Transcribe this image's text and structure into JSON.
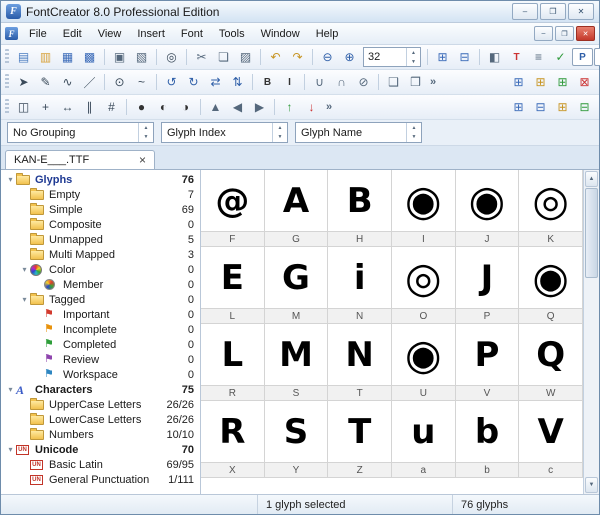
{
  "window": {
    "title": "FontCreator 8.0 Professional Edition",
    "controls": {
      "minimize": "‒",
      "maximize": "❐",
      "close": "✕"
    }
  },
  "menu": {
    "items": [
      "File",
      "Edit",
      "View",
      "Insert",
      "Font",
      "Tools",
      "Window",
      "Help"
    ]
  },
  "toolbars": {
    "rows": [
      [
        {
          "type": "grip"
        },
        {
          "type": "icon",
          "name": "new-font-icon",
          "glyph": "▤",
          "color": "#4a7cc0"
        },
        {
          "type": "icon",
          "name": "open-font-icon",
          "glyph": "▥",
          "color": "#d8a23c"
        },
        {
          "type": "icon",
          "name": "save-font-icon",
          "glyph": "▦",
          "color": "#3a6ab8"
        },
        {
          "type": "icon",
          "name": "save-all-icon",
          "glyph": "▩",
          "color": "#3a6ab8"
        },
        {
          "type": "sep"
        },
        {
          "type": "icon",
          "name": "print-icon",
          "glyph": "▣",
          "color": "#55687c"
        },
        {
          "type": "icon",
          "name": "print-preview-icon",
          "glyph": "▧",
          "color": "#55687c"
        },
        {
          "type": "sep"
        },
        {
          "type": "icon",
          "name": "find-icon",
          "glyph": "◎",
          "color": "#3a4a5a"
        },
        {
          "type": "sep"
        },
        {
          "type": "icon",
          "name": "cut-icon",
          "glyph": "✂",
          "color": "#55687c"
        },
        {
          "type": "icon",
          "name": "copy-icon",
          "glyph": "❏",
          "color": "#55687c"
        },
        {
          "type": "icon",
          "name": "paste-icon",
          "glyph": "▨",
          "color": "#55687c"
        },
        {
          "type": "sep"
        },
        {
          "type": "icon",
          "name": "undo-icon",
          "glyph": "↶",
          "color": "#c79422"
        },
        {
          "type": "icon",
          "name": "redo-icon",
          "glyph": "↷",
          "color": "#c79422"
        },
        {
          "type": "sep"
        },
        {
          "type": "icon",
          "name": "zoom-out-icon",
          "glyph": "⊖",
          "color": "#2f5fa8"
        },
        {
          "type": "icon",
          "name": "zoom-in-icon",
          "glyph": "⊕",
          "color": "#2f5fa8"
        },
        {
          "type": "zoom",
          "value": "32"
        },
        {
          "type": "sep"
        },
        {
          "type": "icon",
          "name": "glyph-grid-icon",
          "glyph": "⊞",
          "color": "#3a6ab8"
        },
        {
          "type": "icon",
          "name": "cascade-windows-icon",
          "glyph": "⊟",
          "color": "#3a6ab8"
        },
        {
          "type": "sep"
        },
        {
          "type": "icon",
          "name": "transform-icon",
          "glyph": "◧",
          "color": "#55687c"
        },
        {
          "type": "icon",
          "name": "test-font-icon",
          "glyph": "T",
          "color": "#cc3333",
          "letter": true
        },
        {
          "type": "icon",
          "name": "glyph-names-icon",
          "glyph": "≡",
          "color": "#55687c"
        },
        {
          "type": "icon",
          "name": "validate-icon",
          "glyph": "✓",
          "color": "#2f9a3a"
        },
        {
          "type": "icon",
          "name": "properties-icon",
          "glyph": "P",
          "color": "#2f5fa8",
          "letter": true,
          "box": true
        },
        {
          "type": "icon",
          "name": "ti-icon",
          "glyph": "TI",
          "color": "#2f5fa8",
          "letter": true,
          "box": true
        },
        {
          "type": "gap"
        },
        {
          "type": "icon",
          "name": "pilcrow-icon",
          "glyph": "¶",
          "color": "#3a6ab8"
        },
        {
          "type": "icon",
          "name": "compare-icon",
          "glyph": "◫",
          "color": "#3a6ab8"
        },
        {
          "type": "chevron"
        }
      ],
      [
        {
          "type": "grip"
        },
        {
          "type": "icon",
          "name": "pointer-icon",
          "glyph": "➤",
          "color": "#3a4a5a"
        },
        {
          "type": "icon",
          "name": "draw-icon",
          "glyph": "✎",
          "color": "#3a4a5a"
        },
        {
          "type": "icon",
          "name": "contour-icon",
          "glyph": "∿",
          "color": "#3a4a5a"
        },
        {
          "type": "icon",
          "name": "knife-icon",
          "glyph": "／",
          "color": "#3a4a5a"
        },
        {
          "type": "sep"
        },
        {
          "type": "icon",
          "name": "add-point-icon",
          "glyph": "⊙",
          "color": "#3a4a5a"
        },
        {
          "type": "icon",
          "name": "curve-icon",
          "glyph": "~",
          "color": "#3a4a5a"
        },
        {
          "type": "sep"
        },
        {
          "type": "icon",
          "name": "rotate-ccw-icon",
          "glyph": "↺",
          "color": "#2f5fa8"
        },
        {
          "type": "icon",
          "name": "rotate-cw-icon",
          "glyph": "↻",
          "color": "#2f5fa8"
        },
        {
          "type": "icon",
          "name": "flip-horizontal-icon",
          "glyph": "⇄",
          "color": "#2f5fa8"
        },
        {
          "type": "icon",
          "name": "flip-vertical-icon",
          "glyph": "⇅",
          "color": "#2f5fa8"
        },
        {
          "type": "sep"
        },
        {
          "type": "icon",
          "name": "bold-icon",
          "glyph": "B",
          "color": "#333333",
          "letter": true
        },
        {
          "type": "icon",
          "name": "italic-icon",
          "glyph": "I",
          "color": "#333333",
          "letter": true
        },
        {
          "type": "sep"
        },
        {
          "type": "icon",
          "name": "union-icon",
          "glyph": "∪",
          "color": "#55687c"
        },
        {
          "type": "icon",
          "name": "intersect-icon",
          "glyph": "∩",
          "color": "#55687c"
        },
        {
          "type": "icon",
          "name": "exclude-icon",
          "glyph": "⊘",
          "color": "#55687c"
        },
        {
          "type": "sep"
        },
        {
          "type": "icon",
          "name": "group-icon",
          "glyph": "❑",
          "color": "#55687c"
        },
        {
          "type": "icon",
          "name": "ungroup-icon",
          "glyph": "❒",
          "color": "#55687c"
        },
        {
          "type": "chevron"
        },
        {
          "type": "gap"
        },
        {
          "type": "icon",
          "name": "tile-horizontal-icon",
          "glyph": "⊞",
          "color": "#3a6ab8"
        },
        {
          "type": "icon",
          "name": "tile-vertical-icon",
          "glyph": "⊞",
          "color": "#c79422"
        },
        {
          "type": "icon",
          "name": "new-window-icon",
          "glyph": "⊞",
          "color": "#2f9a3a"
        },
        {
          "type": "icon",
          "name": "close-window-icon",
          "glyph": "⊠",
          "color": "#cc3333"
        }
      ],
      [
        {
          "type": "grip"
        },
        {
          "type": "icon",
          "name": "eraser-icon",
          "glyph": "◫",
          "color": "#3a4a5a"
        },
        {
          "type": "icon",
          "name": "move-icon",
          "glyph": "+",
          "color": "#3a4a5a"
        },
        {
          "type": "icon",
          "name": "measure-icon",
          "glyph": "↔",
          "color": "#3a4a5a"
        },
        {
          "type": "icon",
          "name": "guides-icon",
          "glyph": "∥",
          "color": "#3a4a5a"
        },
        {
          "type": "icon",
          "name": "snap-grid-icon",
          "glyph": "#",
          "color": "#3a4a5a"
        },
        {
          "type": "sep"
        },
        {
          "type": "icon",
          "name": "ellipse-icon",
          "glyph": "●",
          "color": "#333333"
        },
        {
          "type": "icon",
          "name": "contrast-left-icon",
          "glyph": "◐",
          "color": "#333333"
        },
        {
          "type": "icon",
          "name": "contrast-right-icon",
          "glyph": "◑",
          "color": "#333333"
        },
        {
          "type": "sep"
        },
        {
          "type": "icon",
          "name": "align-top-icon",
          "glyph": "▲",
          "color": "#55687c"
        },
        {
          "type": "icon",
          "name": "align-left-icon",
          "glyph": "◀",
          "color": "#55687c"
        },
        {
          "type": "icon",
          "name": "align-right-icon",
          "glyph": "▶",
          "color": "#55687c"
        },
        {
          "type": "sep"
        },
        {
          "type": "icon",
          "name": "raise-icon",
          "glyph": "↑",
          "color": "#2f9a3a"
        },
        {
          "type": "icon",
          "name": "lower-icon",
          "glyph": "↓",
          "color": "#cc3333"
        },
        {
          "type": "chevron"
        },
        {
          "type": "gap"
        },
        {
          "type": "icon",
          "name": "table-view-icon",
          "glyph": "⊞",
          "color": "#3a6ab8"
        },
        {
          "type": "icon",
          "name": "split-view-icon",
          "glyph": "⊟",
          "color": "#3a6ab8"
        },
        {
          "type": "icon",
          "name": "chart-view-icon",
          "glyph": "⊞",
          "color": "#c79422"
        },
        {
          "type": "icon",
          "name": "report-view-icon",
          "glyph": "⊟",
          "color": "#2f9a3a"
        }
      ]
    ]
  },
  "grouping": {
    "combos": [
      {
        "name": "grouping-select",
        "value": "No Grouping"
      },
      {
        "name": "glyph-index-select",
        "value": "Glyph Index"
      },
      {
        "name": "glyph-name-select",
        "value": "Glyph Name"
      }
    ]
  },
  "tab": {
    "label": "KAN-E___.TTF",
    "close": "×"
  },
  "tree": {
    "items": [
      {
        "label": "Glyphs",
        "count": "76",
        "level": 0,
        "icon": "folder",
        "caret": true,
        "bold": true,
        "color": "#1f3a93"
      },
      {
        "label": "Empty",
        "count": "7",
        "level": 1,
        "icon": "folder"
      },
      {
        "label": "Simple",
        "count": "69",
        "level": 1,
        "icon": "folder"
      },
      {
        "label": "Composite",
        "count": "0",
        "level": 1,
        "icon": "folder"
      },
      {
        "label": "Unmapped",
        "count": "5",
        "level": 1,
        "icon": "folder"
      },
      {
        "label": "Multi Mapped",
        "count": "3",
        "level": 1,
        "icon": "folder"
      },
      {
        "label": "Color",
        "count": "0",
        "level": 1,
        "icon": "wheel",
        "caret": true
      },
      {
        "label": "Member",
        "count": "0",
        "level": 2,
        "icon": "ball"
      },
      {
        "label": "Tagged",
        "count": "0",
        "level": 1,
        "icon": "folder",
        "caret": true
      },
      {
        "label": "Important",
        "count": "0",
        "level": 2,
        "icon": "flag",
        "iconColor": "#d23a2e"
      },
      {
        "label": "Incomplete",
        "count": "0",
        "level": 2,
        "icon": "flag",
        "iconColor": "#e8920c"
      },
      {
        "label": "Completed",
        "count": "0",
        "level": 2,
        "icon": "flag",
        "iconColor": "#2e9e3a"
      },
      {
        "label": "Review",
        "count": "0",
        "level": 2,
        "icon": "flag",
        "iconColor": "#8e44ad"
      },
      {
        "label": "Workspace",
        "count": "0",
        "level": 2,
        "icon": "flag",
        "iconColor": "#2e86c1"
      },
      {
        "label": "Characters",
        "count": "75",
        "level": 0,
        "icon": "chars",
        "caret": true,
        "bold": true
      },
      {
        "label": "UpperCase Letters",
        "count": "26/26",
        "level": 1,
        "icon": "folder"
      },
      {
        "label": "LowerCase Letters",
        "count": "26/26",
        "level": 1,
        "icon": "folder"
      },
      {
        "label": "Numbers",
        "count": "10/10",
        "level": 1,
        "icon": "folder"
      },
      {
        "label": "Unicode",
        "count": "70",
        "level": 0,
        "icon": "un",
        "caret": true,
        "bold": true
      },
      {
        "label": "Basic Latin",
        "count": "69/95",
        "level": 1,
        "icon": "un"
      },
      {
        "label": "General Punctuation",
        "count": "1/111",
        "level": 1,
        "icon": "un"
      }
    ]
  },
  "grid": {
    "cells": [
      {
        "glyph": "@",
        "label": "F"
      },
      {
        "glyph": "A",
        "label": "G"
      },
      {
        "glyph": "B",
        "label": "H"
      },
      {
        "glyph": "◉",
        "label": "I"
      },
      {
        "glyph": "◉",
        "label": "J"
      },
      {
        "glyph": "◎",
        "label": "K"
      },
      {
        "glyph": "E",
        "label": "L"
      },
      {
        "glyph": "G",
        "label": "M"
      },
      {
        "glyph": "i",
        "label": "N"
      },
      {
        "glyph": "◎",
        "label": "O"
      },
      {
        "glyph": "J",
        "label": "P"
      },
      {
        "glyph": "◉",
        "label": "Q"
      },
      {
        "glyph": "L",
        "label": "R"
      },
      {
        "glyph": "M",
        "label": "S"
      },
      {
        "glyph": "N",
        "label": "T"
      },
      {
        "glyph": "◉",
        "label": "U"
      },
      {
        "glyph": "P",
        "label": "V"
      },
      {
        "glyph": "Q",
        "label": "W"
      },
      {
        "glyph": "R",
        "label": "X"
      },
      {
        "glyph": "S",
        "label": "Y"
      },
      {
        "glyph": "T",
        "label": "Z"
      },
      {
        "glyph": "u",
        "label": "a"
      },
      {
        "glyph": "b",
        "label": "b"
      },
      {
        "glyph": "V",
        "label": "c"
      }
    ]
  },
  "status": {
    "selected": "1 glyph selected",
    "glyphs": "76 glyphs"
  },
  "ui": {
    "spin_up": "▲",
    "spin_down": "▼",
    "caret": "▾",
    "flag": "⚑",
    "chars_a": "A",
    "un_label": "UN",
    "chevron": "»",
    "scroll_up": "▲",
    "scroll_down": "▼",
    "app_initial": "F"
  }
}
